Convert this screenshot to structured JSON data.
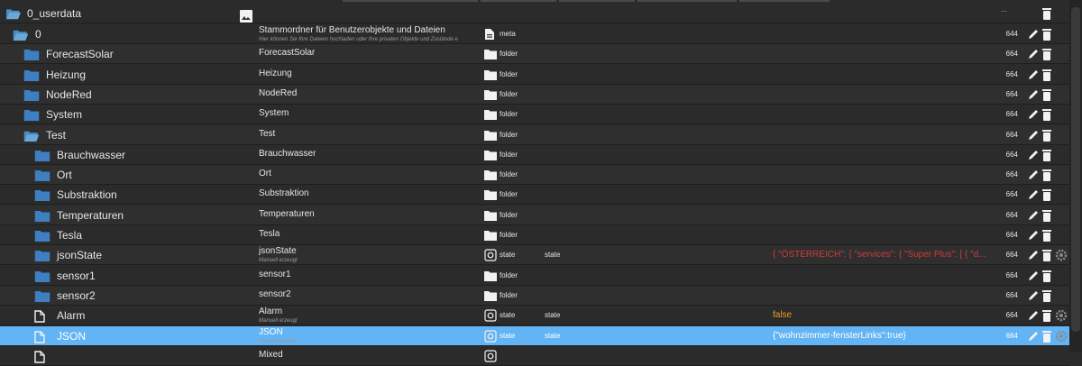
{
  "header": {
    "root_name": "0_userdata",
    "menu_text": "..."
  },
  "rows": [
    {
      "name": "0",
      "indent": 1,
      "icon": "folder-open-icon",
      "label": "Stammordner für Benutzerobjekte und Dateien",
      "sublabel": "Hier können Sie Ihre Dateien hochladen oder Ihre privaten Objekte und Zustände e",
      "type_icon": "file-icon",
      "type": "meta",
      "role": "",
      "value": "",
      "acl": "644",
      "actions": [
        "edit",
        "delete"
      ]
    },
    {
      "name": "ForecastSolar",
      "indent": 2,
      "icon": "folder-icon",
      "label": "ForecastSolar",
      "sublabel": "",
      "type_icon": "folder-icon",
      "type": "folder",
      "role": "",
      "value": "",
      "acl": "664",
      "actions": [
        "edit",
        "delete"
      ]
    },
    {
      "name": "Heizung",
      "indent": 2,
      "icon": "folder-icon",
      "label": "Heizung",
      "sublabel": "",
      "type_icon": "folder-icon",
      "type": "folder",
      "role": "",
      "value": "",
      "acl": "664",
      "actions": [
        "edit",
        "delete"
      ]
    },
    {
      "name": "NodeRed",
      "indent": 2,
      "icon": "folder-icon",
      "label": "NodeRed",
      "sublabel": "",
      "type_icon": "folder-icon",
      "type": "folder",
      "role": "",
      "value": "",
      "acl": "664",
      "actions": [
        "edit",
        "delete"
      ]
    },
    {
      "name": "System",
      "indent": 2,
      "icon": "folder-icon",
      "label": "System",
      "sublabel": "",
      "type_icon": "folder-icon",
      "type": "folder",
      "role": "",
      "value": "",
      "acl": "664",
      "actions": [
        "edit",
        "delete"
      ]
    },
    {
      "name": "Test",
      "indent": 2,
      "icon": "folder-open-icon",
      "label": "Test",
      "sublabel": "",
      "type_icon": "folder-icon",
      "type": "folder",
      "role": "",
      "value": "",
      "acl": "664",
      "actions": [
        "edit",
        "delete"
      ]
    },
    {
      "name": "Brauchwasser",
      "indent": 3,
      "icon": "folder-icon",
      "label": "Brauchwasser",
      "sublabel": "",
      "type_icon": "folder-icon",
      "type": "folder",
      "role": "",
      "value": "",
      "acl": "664",
      "actions": [
        "edit",
        "delete"
      ]
    },
    {
      "name": "Ort",
      "indent": 3,
      "icon": "folder-icon",
      "label": "Ort",
      "sublabel": "",
      "type_icon": "folder-icon",
      "type": "folder",
      "role": "",
      "value": "",
      "acl": "664",
      "actions": [
        "edit",
        "delete"
      ]
    },
    {
      "name": "Substraktion",
      "indent": 3,
      "icon": "folder-icon",
      "label": "Substraktion",
      "sublabel": "",
      "type_icon": "folder-icon",
      "type": "folder",
      "role": "",
      "value": "",
      "acl": "664",
      "actions": [
        "edit",
        "delete"
      ]
    },
    {
      "name": "Temperaturen",
      "indent": 3,
      "icon": "folder-icon",
      "label": "Temperaturen",
      "sublabel": "",
      "type_icon": "folder-icon",
      "type": "folder",
      "role": "",
      "value": "",
      "acl": "664",
      "actions": [
        "edit",
        "delete"
      ]
    },
    {
      "name": "Tesla",
      "indent": 3,
      "icon": "folder-icon",
      "label": "Tesla",
      "sublabel": "",
      "type_icon": "folder-icon",
      "type": "folder",
      "role": "",
      "value": "",
      "acl": "664",
      "actions": [
        "edit",
        "delete"
      ]
    },
    {
      "name": "jsonState",
      "indent": 3,
      "icon": "folder-icon",
      "label": "jsonState",
      "sublabel": "Manuell erzeugt",
      "type_icon": "state-icon",
      "type": "state",
      "role": "state",
      "value": "{ \"ÖSTERREICH\": { \"services\": { \"Super Plus\": [ { \"d...",
      "value_color": "#d13b3b",
      "acl": "664",
      "actions": [
        "edit",
        "delete",
        "settings"
      ]
    },
    {
      "name": "sensor1",
      "indent": 3,
      "icon": "folder-icon",
      "label": "sensor1",
      "sublabel": "",
      "type_icon": "folder-icon",
      "type": "folder",
      "role": "",
      "value": "",
      "acl": "664",
      "actions": [
        "edit",
        "delete"
      ]
    },
    {
      "name": "sensor2",
      "indent": 3,
      "icon": "folder-icon",
      "label": "sensor2",
      "sublabel": "",
      "type_icon": "folder-icon",
      "type": "folder",
      "role": "",
      "value": "",
      "acl": "664",
      "actions": [
        "edit",
        "delete"
      ]
    },
    {
      "name": "Alarm",
      "indent": 3,
      "icon": "file-outline-icon",
      "label": "Alarm",
      "sublabel": "Manuell erzeugt",
      "type_icon": "state-icon",
      "type": "state",
      "role": "state",
      "value": "false",
      "value_color": "#f0a020",
      "acl": "664",
      "actions": [
        "edit",
        "delete",
        "settings"
      ]
    },
    {
      "name": "JSON",
      "indent": 3,
      "icon": "file-outline-icon",
      "label": "JSON",
      "sublabel": "Manuell erzeugt",
      "type_icon": "state-icon",
      "type": "state",
      "role": "state",
      "value": "{\"wohnzimmer-fensterLinks\":true}",
      "value_color": "#ffffff",
      "acl": "664",
      "actions": [
        "edit",
        "delete",
        "settings"
      ],
      "selected": true
    },
    {
      "name": "",
      "indent": 3,
      "icon": "file-outline-icon",
      "label": "Mixed",
      "sublabel": "",
      "type_icon": "state-icon",
      "type": "",
      "role": "",
      "value": "",
      "value_color": "#d13b3b",
      "acl": "",
      "actions": []
    }
  ]
}
